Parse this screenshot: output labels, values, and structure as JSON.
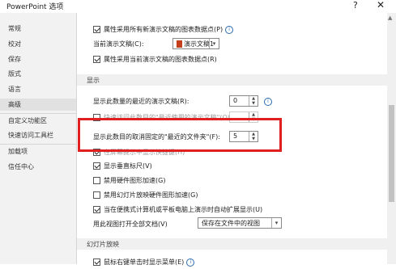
{
  "window": {
    "title": "PowerPoint 选项",
    "help": "?",
    "close": "✕"
  },
  "sidebar": {
    "items": [
      {
        "label": "常规"
      },
      {
        "label": "校对"
      },
      {
        "label": "保存"
      },
      {
        "label": "版式"
      },
      {
        "label": "语言"
      },
      {
        "label": "高级"
      },
      {
        "label": "自定义功能区"
      },
      {
        "label": "快速访问工具栏"
      },
      {
        "label": "加载项"
      },
      {
        "label": "信任中心"
      }
    ],
    "active": "高级"
  },
  "chart_options": {
    "opt1": "属性采用所有新演示文稿的图表数据点(P)",
    "current_doc_label": "当前演示文稿(C):",
    "current_doc_value": "演示文稿1",
    "opt2": "属性采用当前演示文稿的图表数据点(R)"
  },
  "display": {
    "section": "显示",
    "recent_count_label": "显示此数量的最近的演示文稿(R):",
    "recent_count_value": "0",
    "quick_access_label": "快速访问此数目的\"最近使用的演示文稿\"(Q):",
    "unpinned_label": "显示此数目的取消固定的\"最近的文件夹\"(F):",
    "unpinned_value": "5",
    "shortcut_keys_label": "在屏幕提示中显示快捷键(H)",
    "vertical_ruler_label": "显示垂直标尺(V)",
    "disable_hw_accel_label": "禁用硬件图形加速(G)",
    "disable_slideshow_hw_label": "禁用幻灯片放映硬件图形加速(G)",
    "auto_extend_label": "当在便携式计算机或平板电脑上演示时自动扩展显示(U)",
    "open_docs_label": "用此视图打开全部文档(V)",
    "open_docs_value": "保存在文件中的视图"
  },
  "slideshow": {
    "section": "幻灯片放映",
    "right_click_label": "鼠标右键单击时显示菜单(E)"
  }
}
